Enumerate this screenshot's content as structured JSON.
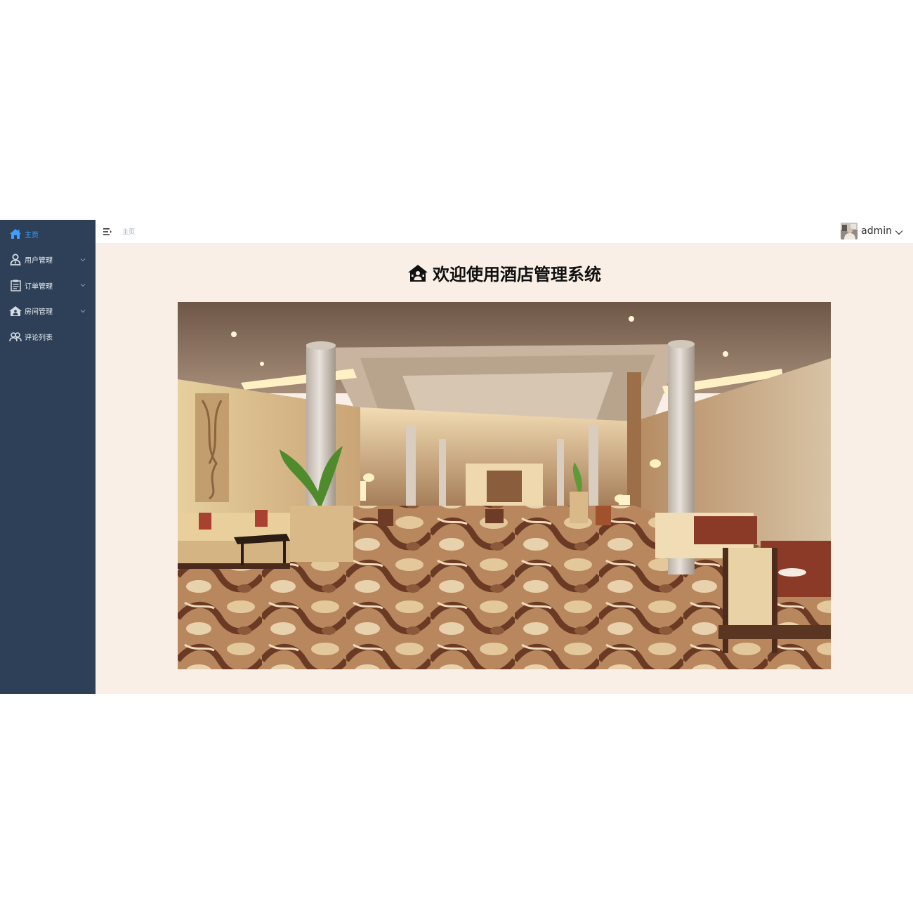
{
  "sidebar": {
    "items": [
      {
        "label": "主页",
        "icon": "home-icon",
        "active": true
      },
      {
        "label": "用户管理",
        "icon": "user-icon",
        "has_children": true
      },
      {
        "label": "订单管理",
        "icon": "order-icon",
        "has_children": true
      },
      {
        "label": "房间管理",
        "icon": "hotel-icon",
        "has_children": true
      },
      {
        "label": "评论列表",
        "icon": "comment-icon",
        "has_children": false
      }
    ],
    "background": "#2e4057",
    "active_color": "#409eff"
  },
  "header": {
    "breadcrumb": "主页",
    "username": "admin"
  },
  "main": {
    "welcome_title": "欢迎使用酒店管理系统",
    "background": "#faefe6"
  }
}
